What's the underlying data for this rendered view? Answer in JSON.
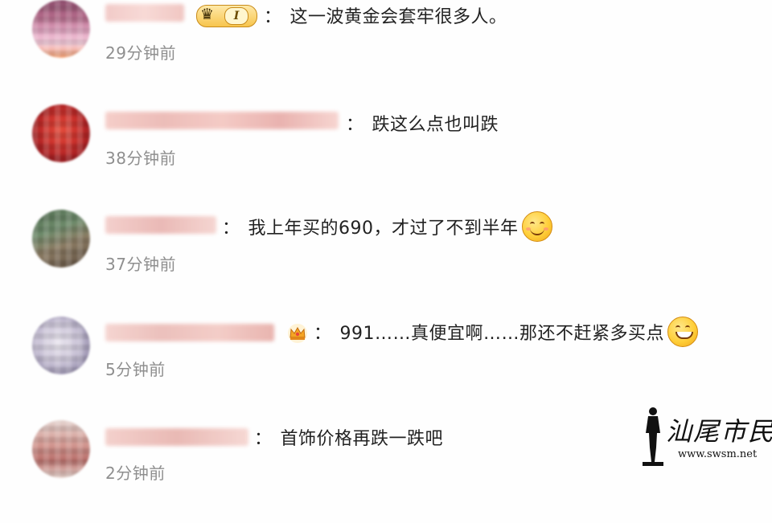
{
  "comments": [
    {
      "text": "这一波黄金会套牢很多人。",
      "time": "29分钟前",
      "badge": {
        "type": "vip",
        "level": "I"
      }
    },
    {
      "text": "跌这么点也叫跌",
      "time": "38分钟前"
    },
    {
      "text": "我上年买的690，才过了不到半年",
      "time": "37分钟前",
      "emoji": "smile-emoji"
    },
    {
      "text": "991……真便宜啊……那还不赶紧多买点",
      "time": "5分钟前",
      "badge": {
        "type": "crown"
      },
      "emoji": "grin-emoji"
    },
    {
      "text": "首饰价格再跌一跌吧",
      "time": "2分钟前"
    }
  ],
  "colon": "：",
  "watermark": {
    "title": "汕尾市民网",
    "url": "www.swsm.net"
  },
  "colors": {
    "text": "#222222",
    "time": "#8f8f8f",
    "vip_gold": "#f7c54d"
  }
}
